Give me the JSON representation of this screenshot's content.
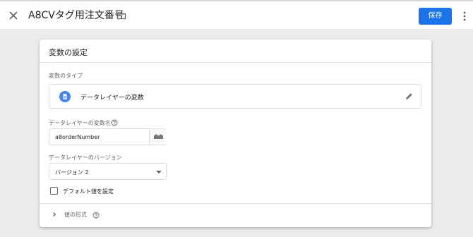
{
  "header": {
    "title": "A8CVタグ用注文番号",
    "save_label": "保存"
  },
  "card": {
    "title": "変数の設定",
    "type_section": {
      "label": "変数のタイプ",
      "selected_type": "データレイヤーの変数"
    },
    "name_field": {
      "label": "データレイヤーの変数名",
      "value": "a8orderNumber"
    },
    "version_field": {
      "label": "データレイヤーのバージョン",
      "selected": "バージョン 2"
    },
    "default_checkbox": {
      "label": "デフォルト値を設定",
      "checked": false
    },
    "format_section": {
      "label": "値の形式"
    }
  },
  "colors": {
    "primary": "#1a73e8",
    "type_icon": "#4285f4",
    "background": "#ececec"
  },
  "icons": [
    "close-icon",
    "folder-icon",
    "more-vert-icon",
    "variable-type-icon",
    "edit-icon",
    "help-icon",
    "variable-picker-icon",
    "dropdown-caret-icon",
    "chevron-right-icon"
  ]
}
